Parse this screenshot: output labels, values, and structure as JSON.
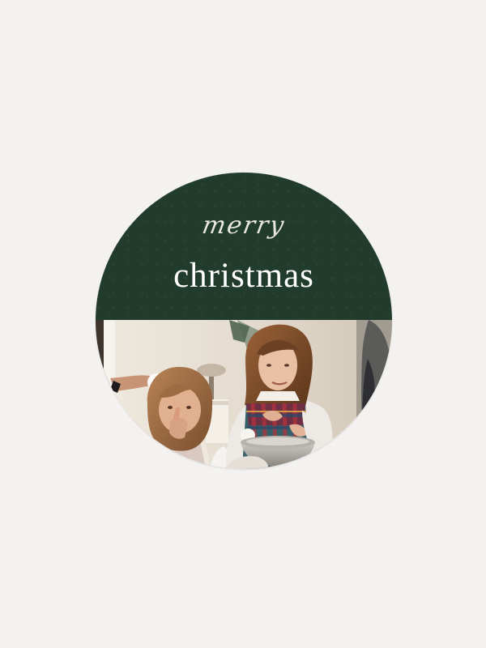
{
  "sticker": {
    "script_word": "merry",
    "headline": "christmas"
  },
  "colors": {
    "page_background": "#f3f2f1",
    "band_green": "#213c2c",
    "text_light": "#ffffff"
  },
  "photo": {
    "icon": "family-photo"
  }
}
